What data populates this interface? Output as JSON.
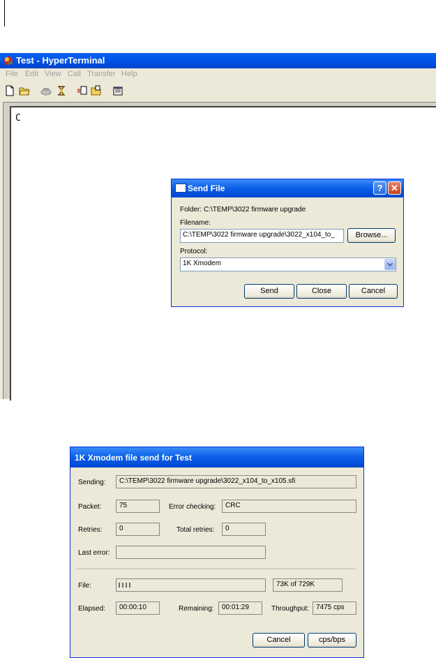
{
  "app": {
    "title": "Test - HyperTerminal",
    "menu": [
      "File",
      "Edit",
      "View",
      "Call",
      "Transfer",
      "Help"
    ],
    "toolbar_icons": [
      "new-icon",
      "open-icon",
      "connect-icon",
      "disconnect-icon",
      "send-icon",
      "receive-icon",
      "properties-icon"
    ],
    "terminal_text": "C"
  },
  "send_file": {
    "title": "Send File",
    "help_label": "?",
    "close_label": "✕",
    "folder_label": "Folder:",
    "folder_value": "C:\\TEMP\\3022 firmware upgrade",
    "filename_label": "Filename:",
    "filename_value": "C:\\TEMP\\3022 firmware upgrade\\3022_x104_to_",
    "browse_label": "Browse...",
    "protocol_label": "Protocol:",
    "protocol_value": "1K Xmodem",
    "send_label": "Send",
    "close_button_label": "Close",
    "cancel_label": "Cancel"
  },
  "transfer": {
    "title": "1K Xmodem file send for Test",
    "sending_label": "Sending:",
    "sending_value": "C:\\TEMP\\3022 firmware upgrade\\3022_x104_to_x105.sfi",
    "packet_label": "Packet:",
    "packet_value": "75",
    "error_checking_label": "Error checking:",
    "error_checking_value": "CRC",
    "retries_label": "Retries:",
    "retries_value": "0",
    "total_retries_label": "Total retries:",
    "total_retries_value": "0",
    "last_error_label": "Last error:",
    "last_error_value": "",
    "file_label": "File:",
    "progress_fraction": 0.1,
    "file_value": "73K of 729K",
    "elapsed_label": "Elapsed:",
    "elapsed_value": "00:00:10",
    "remaining_label": "Remaining:",
    "remaining_value": "00:01:29",
    "throughput_label": "Throughput:",
    "throughput_value": "7475 cps",
    "cancel_label": "Cancel",
    "cps_label": "cps/bps"
  }
}
